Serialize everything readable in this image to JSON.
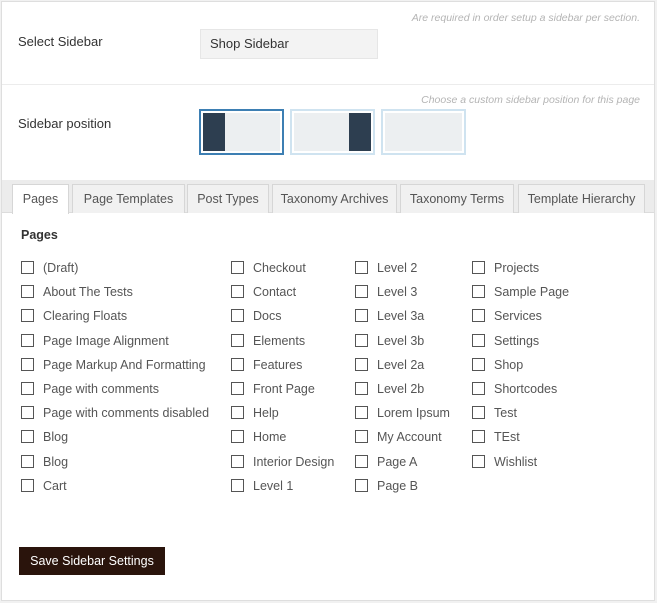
{
  "select_sidebar": {
    "hint": "Are required in order setup a sidebar per section.",
    "label": "Select Sidebar",
    "value": "Shop Sidebar"
  },
  "sidebar_position": {
    "hint": "Choose a custom sidebar position for this page",
    "label": "Sidebar position",
    "options": [
      {
        "name": "left",
        "selected": true
      },
      {
        "name": "right",
        "selected": false
      },
      {
        "name": "none",
        "selected": false
      }
    ],
    "colors": {
      "bar": "#2d3e50",
      "selected_border": "#3d7fb3"
    }
  },
  "tabs": [
    {
      "label": "Pages",
      "active": true
    },
    {
      "label": "Page Templates",
      "active": false
    },
    {
      "label": "Post Types",
      "active": false
    },
    {
      "label": "Taxonomy Archives",
      "active": false
    },
    {
      "label": "Taxonomy Terms",
      "active": false
    },
    {
      "label": "Template Hierarchy",
      "active": false
    }
  ],
  "pages": {
    "title": "Pages",
    "columns": [
      [
        "(Draft)",
        "About The Tests",
        "Clearing Floats",
        "Page Image Alignment",
        "Page Markup And Formatting",
        "Page with comments",
        "Page with comments disabled",
        "Blog",
        "Blog",
        "Cart"
      ],
      [
        "Checkout",
        "Contact",
        "Docs",
        "Elements",
        "Features",
        "Front Page",
        "Help",
        "Home",
        "Interior Design",
        "Level 1"
      ],
      [
        "Level 2",
        "Level 3",
        "Level 3a",
        "Level 3b",
        "Level 2a",
        "Level 2b",
        "Lorem Ipsum",
        "My Account",
        "Page A",
        "Page B"
      ],
      [
        "Projects",
        "Sample Page",
        "Services",
        "Settings",
        "Shop",
        "Shortcodes",
        "Test",
        "TEst",
        "Wishlist"
      ]
    ]
  },
  "save_button": {
    "label": "Save Sidebar Settings",
    "color": "#2a140c"
  }
}
